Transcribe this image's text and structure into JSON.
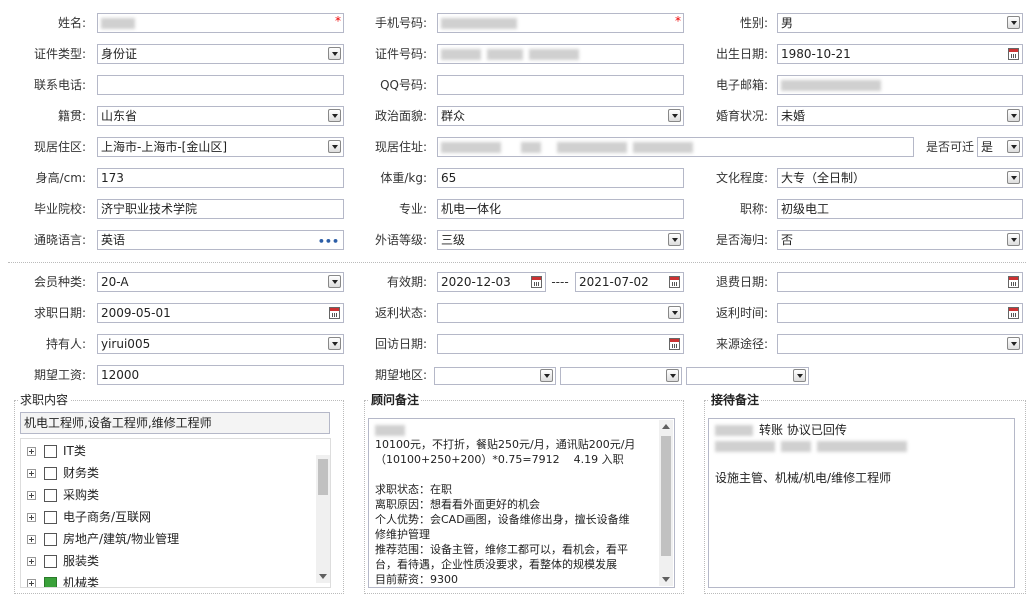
{
  "row1": {
    "name_label": "姓名:",
    "phone_label": "手机号码:",
    "gender_label": "性别:",
    "gender_value": "男"
  },
  "row2": {
    "idtype_label": "证件类型:",
    "idtype_value": "身份证",
    "idnum_label": "证件号码:",
    "birth_label": "出生日期:",
    "birth_value": "1980-10-21"
  },
  "row3": {
    "tel_label": "联系电话:",
    "qq_label": "QQ号码:",
    "email_label": "电子邮箱:"
  },
  "row4": {
    "origin_label": "籍贯:",
    "origin_value": "山东省",
    "political_label": "政治面貌:",
    "political_value": "群众",
    "marital_label": "婚育状况:",
    "marital_value": "未婚"
  },
  "row5": {
    "area_label": "现居住区:",
    "area_value": "上海市-上海市-[金山区]",
    "addr_label": "现居住址:",
    "relocate_label": "是否可迁",
    "relocate_value": "是"
  },
  "row6": {
    "height_label": "身高/cm:",
    "height_value": "173",
    "weight_label": "体重/kg:",
    "weight_value": "65",
    "edu_label": "文化程度:",
    "edu_value": "大专（全日制）"
  },
  "row7": {
    "school_label": "毕业院校:",
    "school_value": "济宁职业技术学院",
    "major_label": "专业:",
    "major_value": "机电一体化",
    "title_label": "职称:",
    "title_value": "初级电工"
  },
  "row8": {
    "lang_label": "通晓语言:",
    "lang_value": "英语",
    "langlevel_label": "外语等级:",
    "langlevel_value": "三级",
    "overseas_label": "是否海归:",
    "overseas_value": "否"
  },
  "member": {
    "type_label": "会员种类:",
    "type_value": "20-A",
    "valid_label": "有效期:",
    "valid_from": "2020-12-03",
    "valid_sep": "----",
    "valid_to": "2021-07-02",
    "refund_label": "退费日期:",
    "jobdate_label": "求职日期:",
    "jobdate_value": "2009-05-01",
    "rebate_status_label": "返利状态:",
    "rebate_time_label": "返利时间:",
    "holder_label": "持有人:",
    "holder_value": "yirui005",
    "visit_label": "回访日期:",
    "source_label": "来源途径:",
    "salary_label": "期望工资:",
    "salary_value": "12000",
    "region_label": "期望地区:"
  },
  "job_panel": {
    "title": "求职内容",
    "summary": "机电工程师,设备工程师,维修工程师",
    "tree": [
      {
        "label": "IT类",
        "checked": false
      },
      {
        "label": "财务类",
        "checked": false
      },
      {
        "label": "采购类",
        "checked": false
      },
      {
        "label": "电子商务/互联网",
        "checked": false
      },
      {
        "label": "房地产/建筑/物业管理",
        "checked": false
      },
      {
        "label": "服装类",
        "checked": false
      },
      {
        "label": "机械类",
        "checked": true
      }
    ]
  },
  "consultant_panel": {
    "title": "顾问备注",
    "lines": [
      "10100元，不打折，餐贴250元/月，通讯贴200元/月",
      "（10100+250+200）*0.75=7912    4.19 入职",
      "",
      "求职状态：在职",
      "离职原因：想看看外面更好的机会",
      "个人优势：会CAD画图，设备维修出身，擅长设备维",
      "修维护管理",
      "推荐范围：设备主管，维修工都可以，看机会，看平",
      "台，看待遇，企业性质没要求，看整体的规模发展",
      "目前薪资：9300"
    ]
  },
  "reception_panel": {
    "title": "接待备注",
    "line1": "转账 协议已回传",
    "line3": "设施主管、机械/机电/维修工程师"
  }
}
